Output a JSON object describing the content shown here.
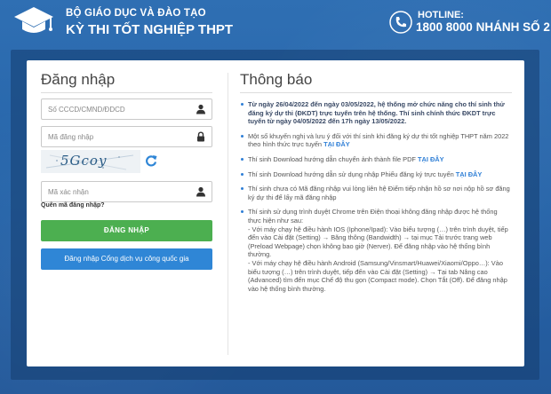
{
  "header": {
    "org_name": "BỘ GIÁO DỤC VÀ ĐÀO TẠO",
    "exam_name": "KỲ THI TỐT NGHIỆP THPT",
    "hotline_label": "HOTLINE:",
    "hotline_number": "1800 8000 NHÁNH SỐ 2"
  },
  "login": {
    "title": "Đăng nhập",
    "id_placeholder": "Số CCCD/CMND/ĐDCD",
    "password_placeholder": "Mã đăng nhập",
    "captcha_text": "5Gcoy",
    "captcha_input_placeholder": "Mã xác nhận",
    "forgot_label": "Quên mã đăng nhập?",
    "login_button": "ĐĂNG NHẬP",
    "portal_button": "Đăng nhập Cổng dịch vụ công quốc gia"
  },
  "notice": {
    "title": "Thông báo",
    "items": [
      {
        "text": "Từ ngày 26/04/2022 đến ngày 03/05/2022, hệ thống mở chức năng cho thí sinh thử đăng ký dự thi (ĐKDT) trực tuyến trên hệ thống. Thí sinh chính thức ĐKDT trực tuyến từ ngày 04/05/2022 đến 17h ngày 13/05/2022.",
        "link": ""
      },
      {
        "text": "Một số khuyến nghị và lưu ý đối với thí sinh khi đăng ký dự thi tốt nghiệp THPT năm 2022 theo hình thức trực tuyến ",
        "link": "TẠI ĐÂY"
      },
      {
        "text": "Thí sinh Download hướng dẫn chuyển ảnh thành file PDF ",
        "link": "TẠI ĐÂY"
      },
      {
        "text": "Thí sinh Download hướng dẫn sử dụng nhập Phiếu đăng ký trực tuyến ",
        "link": "TẠI ĐÂY"
      },
      {
        "text": "Thí sinh chưa có Mã đăng nhập vui lòng liên hệ Điểm tiếp nhận hồ sơ nơi nộp hồ sơ đăng ký dự thi để lấy mã đăng nhập",
        "link": ""
      },
      {
        "text": "Thí sinh sử dụng trình duyệt Chrome trên Điện thoại không đăng nhập được hệ thống thực hiện như sau:",
        "link": "",
        "sub1": "- Với máy chạy hệ điều hành IOS (Iphone/Ipad): Vào biểu tượng (…) trên trình duyệt, tiếp đến vào Cài đặt (Setting) → Băng thông (Bandwidth) → tại mục Tải trước trang web (Preload Webpage) chọn không bao giờ (Nerver). Để đăng nhập vào hệ thống bình thường.",
        "sub2": "- Với máy chạy hệ điều hành Android (Samsung/Vinsmart/Huawei/Xiaomi/Oppo…): Vào biểu tượng (…) trên trình duyệt, tiếp đến vào Cài đặt (Setting) → Tại tab Nâng cao (Advanced) tìm đến mục Chế độ thu gọn (Compact mode). Chọn Tắt (Off). Để đăng nhập vào hệ thống bình thường."
      }
    ]
  },
  "colors": {
    "background": "#2f6fb3",
    "login_button": "#4caf50",
    "portal_button": "#2f86d6",
    "link": "#2f7fd6"
  },
  "icons": {
    "logo": "graduation-cap-icon",
    "hotline": "phone-icon",
    "id_field": "user-icon",
    "password_field": "lock-icon",
    "captcha_refresh": "refresh-icon",
    "captcha_field": "user-icon"
  }
}
